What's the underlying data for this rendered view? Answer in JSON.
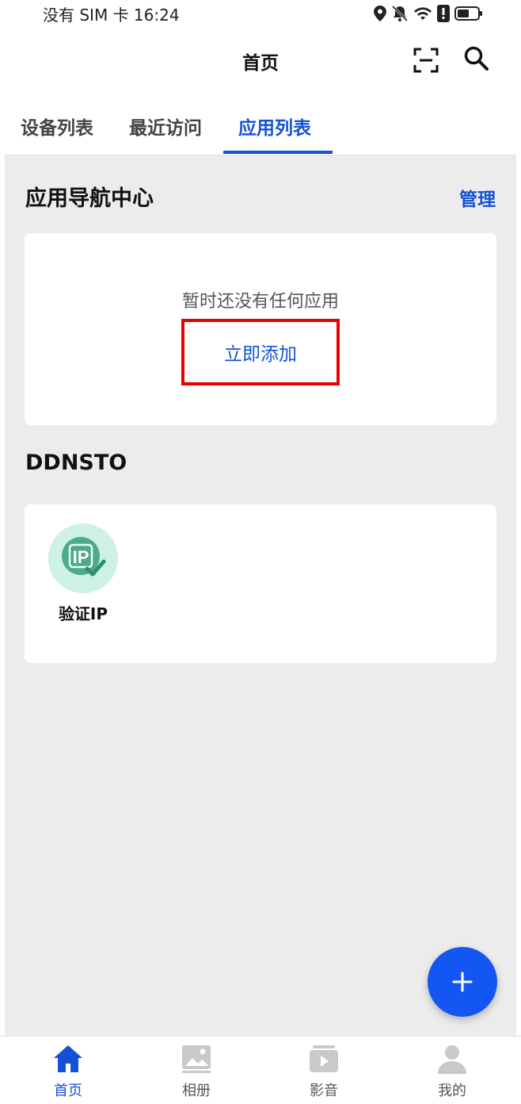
{
  "status_bar": {
    "carrier_time": "没有 SIM 卡 16:24",
    "icons": [
      "location-icon",
      "bell-muted-icon",
      "wifi-icon",
      "alert-icon",
      "battery-icon"
    ]
  },
  "header": {
    "title": "首页",
    "scan_icon": "scan-icon",
    "search_icon": "search-icon"
  },
  "tabs": [
    {
      "label": "设备列表",
      "active": false
    },
    {
      "label": "最近访问",
      "active": false
    },
    {
      "label": "应用列表",
      "active": true
    }
  ],
  "app_center": {
    "title": "应用导航中心",
    "manage_label": "管理",
    "empty_text": "暂时还没有任何应用",
    "add_label": "立即添加"
  },
  "ddnsto": {
    "title": "DDNSTO",
    "apps": [
      {
        "label": "验证IP",
        "icon": "ip-verify-icon",
        "icon_text": "IP"
      }
    ]
  },
  "fab": {
    "icon": "plus-icon"
  },
  "bottom_nav": [
    {
      "label": "首页",
      "icon": "home-icon",
      "active": true
    },
    {
      "label": "相册",
      "icon": "gallery-icon",
      "active": false
    },
    {
      "label": "影音",
      "icon": "media-icon",
      "active": false
    },
    {
      "label": "我的",
      "icon": "profile-icon",
      "active": false
    }
  ],
  "colors": {
    "accent": "#1352d6",
    "fab": "#1456f3",
    "highlight_border": "#e60000",
    "background": "#ececec",
    "app_icon_bg": "#cdf1e2",
    "app_icon_fg": "#4daa8a"
  }
}
